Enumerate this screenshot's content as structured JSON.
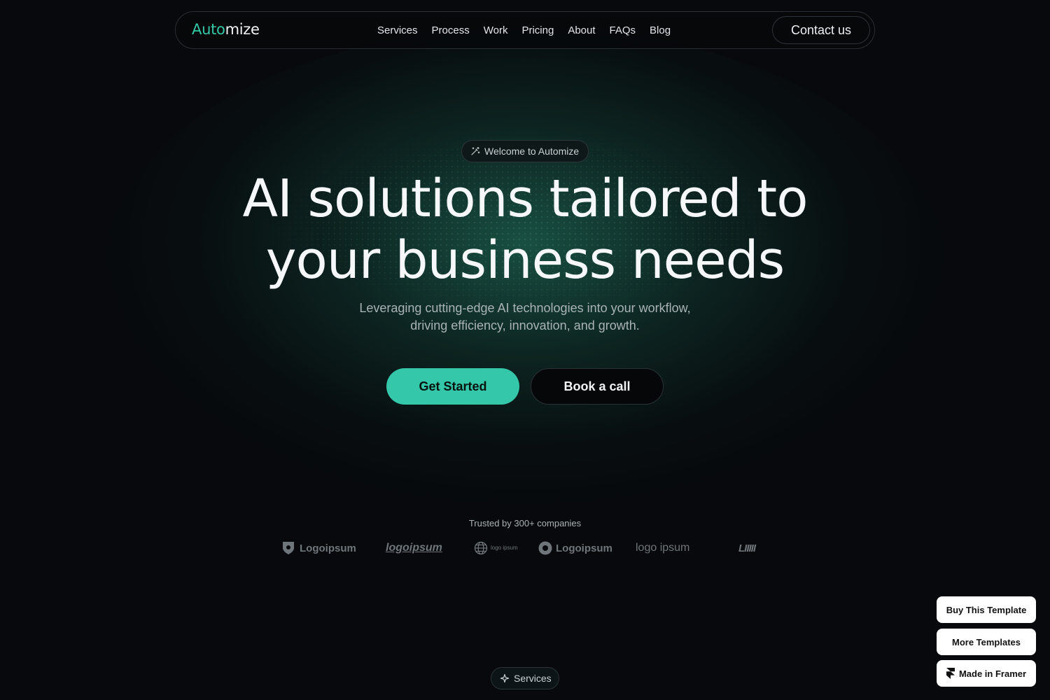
{
  "nav": {
    "brand_part1": "Auto",
    "brand_part2": "mize",
    "links": [
      "Services",
      "Process",
      "Work",
      "Pricing",
      "About",
      "FAQs",
      "Blog"
    ],
    "contact_label": "Contact us"
  },
  "hero": {
    "badge": "Welcome to Automize",
    "headline_line1": "AI solutions tailored to",
    "headline_line2": "your business needs",
    "sub_line1": "Leveraging cutting-edge AI technologies into your workflow,",
    "sub_line2": "driving efficiency, innovation, and growth.",
    "primary_button": "Get Started",
    "secondary_button": "Book a call"
  },
  "trusted": {
    "label": "Trusted by 300+ companies",
    "logos": [
      "Logoipsum",
      "logoipsum",
      "logo ipsum",
      "Logoipsum",
      "logo ipsum",
      "LIIIII"
    ]
  },
  "services_badge": "Services",
  "floating": {
    "buy": "Buy This Template",
    "more": "More Templates",
    "framer": "Made in Framer"
  },
  "colors": {
    "accent": "#34c7a9",
    "background": "#07090c"
  },
  "icons": {
    "badge_icon": "magic-wand-icon",
    "services_icon": "sparkle-icon",
    "framer_icon": "framer-logo-icon"
  }
}
